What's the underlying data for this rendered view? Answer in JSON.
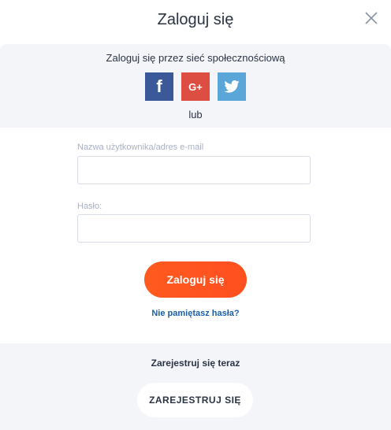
{
  "header": {
    "title": "Zaloguj się"
  },
  "social": {
    "title": "Zaloguj się przez sieć społecznościową",
    "buttons": {
      "facebook": "f",
      "google": "G+"
    },
    "or": "lub"
  },
  "form": {
    "username_label": "Nazwa użytkownika/adres e-mail",
    "username_value": "",
    "password_label": "Hasło:",
    "password_value": "",
    "login_button": "Zaloguj się",
    "forgot_link": "Nie pamiętasz hasła?"
  },
  "register": {
    "title": "Zarejestruj się teraz",
    "button": "ZAREJESTRUJ SIĘ"
  },
  "colors": {
    "accent": "#ff5722",
    "facebook": "#3b5998",
    "google": "#dc4e41",
    "twitter": "#5aa6d9",
    "link": "#1b5fa8",
    "panel": "#f4f5f8"
  },
  "icons": {
    "close": "close-icon",
    "facebook": "facebook-icon",
    "google": "google-plus-icon",
    "twitter": "twitter-icon"
  }
}
